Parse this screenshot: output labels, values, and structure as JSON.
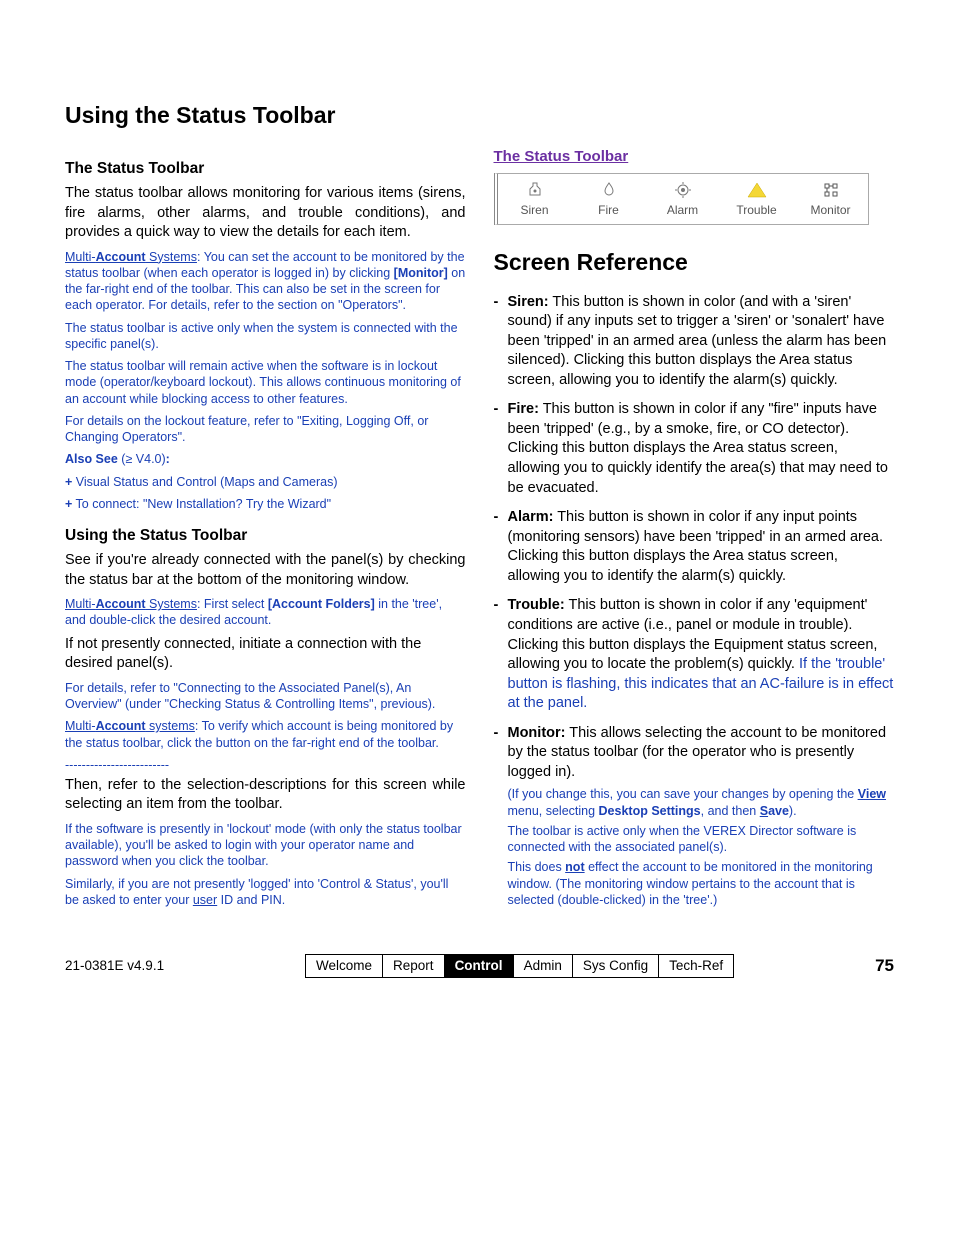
{
  "title": "Using the Status Toolbar",
  "left": {
    "h2_1": "The Status Toolbar",
    "p1": "The status toolbar allows monitoring for various items (sirens, fire alarms, other alarms, and trouble conditions), and provides a quick way to view the details for each item.",
    "note1_a": "Multi-",
    "note1_b": "Account",
    "note1_c": " Systems",
    "note1_d": ":  You can set the account to be monitored by the status toolbar (when each operator is logged in) by clicking ",
    "note1_e": "[Monitor]",
    "note1_f": " on the far-right end of the toolbar.  This can also be set in the screen for each operator.  For details, refer to the section on \"Operators\".",
    "note2": "The status toolbar is active only when the system is connected with the specific panel(s).",
    "note3": "The status toolbar will remain active when the software is in lockout mode (operator/keyboard lockout).  This allows continuous monitoring of an account while blocking access to other features.",
    "note4": "For details on the lockout feature, refer to \"Exiting, Logging Off, or Changing Operators\".",
    "also_see_a": "Also See",
    "also_see_b": " (≥ V4.0)",
    "also_see_c": ":",
    "also1": "+ Visual Status and Control (Maps and Cameras)",
    "also2": "+ To connect:  \"New Installation? Try the Wizard\"",
    "h2_2": "Using the Status Toolbar",
    "p2": "See if you're already connected with the panel(s) by checking the status bar at the bottom of the monitoring window.",
    "note5_a": "Multi-",
    "note5_b": "Account",
    "note5_c": " Systems",
    "note5_d": ":  First select ",
    "note5_e": "[Account Folders]",
    "note5_f": " in the 'tree', and double-click the desired account.",
    "p3": "If not presently connected, initiate a connection with the desired panel(s).",
    "note6": "For details, refer to \"Connecting to the Associated Panel(s), An Overview\" (under \"Checking Status & Controlling Items\", previous).",
    "note7_a": "Multi-",
    "note7_b": "Account",
    "note7_c": " systems",
    "note7_d": ":  To verify which account is being monitored by the status toolbar, click the button on the far-right end of the toolbar.",
    "divider": "-------------------------",
    "p4": "Then, refer to the selection-descriptions for this screen while selecting an item from the toolbar.",
    "note8": "If the software is presently in 'lockout' mode (with only the status toolbar available), you'll be asked to login with your operator name and password when you click the toolbar.",
    "note9_a": "Similarly, if you are not presently 'logged' into 'Control & Status', you'll be asked to enter your ",
    "note9_b": "user",
    "note9_c": " ID and PIN."
  },
  "right": {
    "purple": "The Status Toolbar",
    "toolbar": [
      "Siren",
      "Fire",
      "Alarm",
      "Trouble",
      "Monitor"
    ],
    "h1": "Screen Reference",
    "siren_l": "Siren:",
    "siren_t": " This button is shown in color (and with a 'siren' sound) if any inputs set to trigger a 'siren' or 'sonalert' have been 'tripped' in an armed area (unless the alarm has been silenced). Clicking this button displays the Area status screen, allowing you to identify the alarm(s) quickly.",
    "fire_l": "Fire:",
    "fire_t": " This button is shown in color if any \"fire\" inputs have been 'tripped' (e.g., by a smoke, fire, or CO detector).  Clicking this button displays the Area status screen, allowing you to quickly identify the area(s) that may need to be evacuated.",
    "alarm_l": "Alarm:",
    "alarm_t": " This button is shown in color if any input points (monitoring sensors) have been 'tripped' in an armed area.  Clicking this button displays the Area status screen, allowing you to identify the alarm(s) quickly.",
    "trouble_l": "Trouble:",
    "trouble_t1": "  This button is shown in color if any 'equipment' conditions are active (i.e., panel or module in trouble).  Clicking this button displays the Equipment status screen, allowing you to locate the problem(s) quickly.  ",
    "trouble_t2": "If the 'trouble' button is flashing, this indicates that an AC-failure is in effect at the panel.",
    "monitor_l": "Monitor:",
    "monitor_t1": "  This allows selecting the account to be monitored by the status toolbar (for the operator who is presently logged in).",
    "monitor_t2a": "(If you change this, you can save your changes by opening the ",
    "monitor_t2b": "View",
    "monitor_t2c": " menu, selecting  ",
    "monitor_t2d": "Desktop Settings",
    "monitor_t2e": ", and then ",
    "monitor_t2f": "Save",
    "monitor_t2g": ").",
    "monitor_t3": "The toolbar is active only when the VEREX Director software is connected with the associated panel(s).",
    "monitor_t4a": "This does ",
    "monitor_t4b": "not",
    "monitor_t4c": " effect the account to be monitored in the monitoring window.  (The monitoring window pertains to the account that is selected (double-clicked) in the 'tree'.)"
  },
  "footer": {
    "doc": "21-0381E v4.9.1",
    "tabs": [
      "Welcome",
      "Report",
      "Control",
      "Admin",
      "Sys Config",
      "Tech-Ref"
    ],
    "active": 2,
    "page": "75"
  }
}
